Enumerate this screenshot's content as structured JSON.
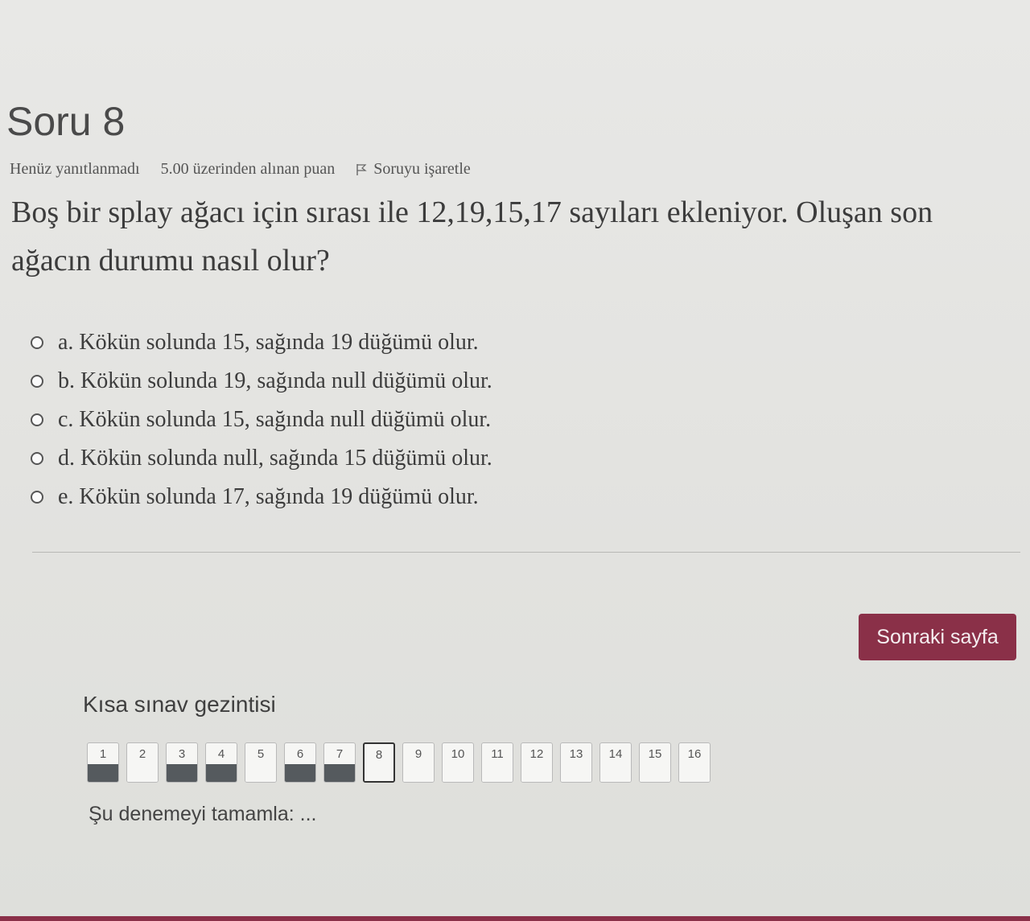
{
  "question": {
    "title": "Soru 8",
    "status": "Henüz yanıtlanmadı",
    "grade": "5.00 üzerinden alınan puan",
    "flag_label": "Soruyu işaretle",
    "text": "Boş bir splay ağacı için sırası ile 12,19,15,17 sayıları ekleniyor. Oluşan son ağacın durumu nasıl olur?",
    "answers": [
      "a. Kökün solunda 15, sağında 19 düğümü olur.",
      "b. Kökün solunda 19, sağında null düğümü olur.",
      "c. Kökün solunda 15, sağında null düğümü olur.",
      "d. Kökün solunda null, sağında 15 düğümü olur.",
      "e. Kökün solunda 17, sağında 19 düğümü olur."
    ]
  },
  "next_button": "Sonraki sayfa",
  "quiz_nav": {
    "title": "Kısa sınav gezintisi",
    "questions": [
      "1",
      "2",
      "3",
      "4",
      "5",
      "6",
      "7",
      "8",
      "9",
      "10",
      "11",
      "12",
      "13",
      "14",
      "15",
      "16"
    ],
    "answered": [
      1,
      3,
      4,
      6,
      7
    ],
    "current": 8,
    "finish_link": "Şu denemeyi tamamla: ..."
  },
  "colors": {
    "accent": "#8a3048",
    "answered_fill": "#555a5e"
  },
  "icons": {
    "flag": "flag-icon",
    "radio": "radio-icon"
  }
}
